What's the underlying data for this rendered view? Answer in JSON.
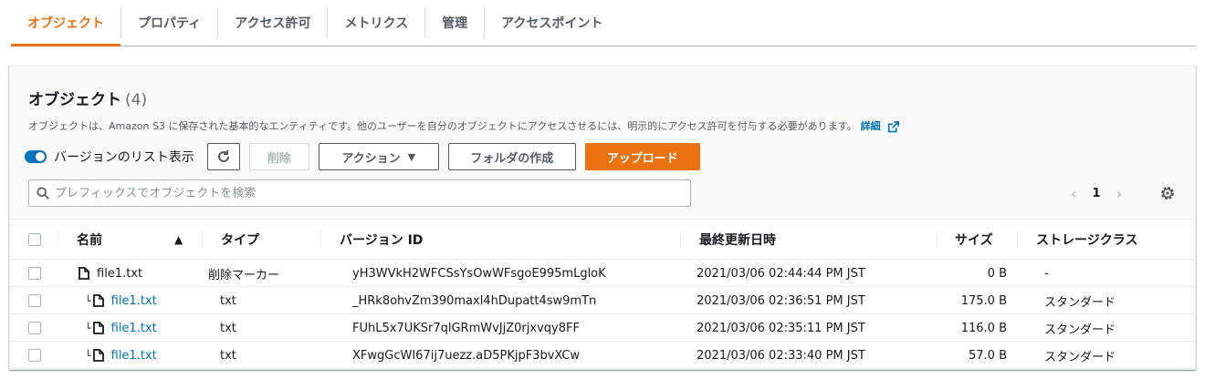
{
  "tabs": [
    {
      "label": "オブジェクト",
      "active": true
    },
    {
      "label": "プロパティ"
    },
    {
      "label": "アクセス許可"
    },
    {
      "label": "メトリクス"
    },
    {
      "label": "管理"
    },
    {
      "label": "アクセスポイント"
    }
  ],
  "panel": {
    "title": "オブジェクト",
    "count": "(4)",
    "description": "オブジェクトは、Amazon S3 に保存された基本的なエンティティです。他のユーザーを自分のオブジェクトにアクセスさせるには、明示的にアクセス許可を付与する必要があります。",
    "info_link": "詳細"
  },
  "toolbar": {
    "toggle_label": "バージョンのリスト表示",
    "delete": "削除",
    "actions": "アクション",
    "create_folder": "フォルダの作成",
    "upload": "アップロード"
  },
  "search": {
    "placeholder": "プレフィックスでオブジェクトを検索"
  },
  "pagination": {
    "page": "1"
  },
  "table": {
    "headers": {
      "name": "名前",
      "type": "タイプ",
      "version_id": "バージョン ID",
      "last_modified": "最終更新日時",
      "size": "サイズ",
      "storage_class": "ストレージクラス"
    },
    "rows": [
      {
        "name": "file1.txt",
        "type": "削除マーカー",
        "version_id": "yH3WVkH2WFCSsYsOwWFsgoE995mLgloK",
        "last_modified": "2021/03/06 02:44:44 PM JST",
        "size": "0 B",
        "storage_class": "-"
      },
      {
        "name": "file1.txt",
        "type": "txt",
        "version_id": "_HRk8ohvZm390maxl4hDupatt4sw9mTn",
        "last_modified": "2021/03/06 02:36:51 PM JST",
        "size": "175.0 B",
        "storage_class": "スタンダード"
      },
      {
        "name": "file1.txt",
        "type": "txt",
        "version_id": "FUhL5x7UKSr7qlGRmWvJjZ0rjxvqy8FF",
        "last_modified": "2021/03/06 02:35:11 PM JST",
        "size": "116.0 B",
        "storage_class": "スタンダード"
      },
      {
        "name": "file1.txt",
        "type": "txt",
        "version_id": "XFwgGcWI67ij7uezz.aD5PKjpF3bvXCw",
        "last_modified": "2021/03/06 02:33:40 PM JST",
        "size": "57.0 B",
        "storage_class": "スタンダード"
      }
    ]
  },
  "colors": {
    "accent": "#ec7211",
    "link": "#0073bb"
  }
}
